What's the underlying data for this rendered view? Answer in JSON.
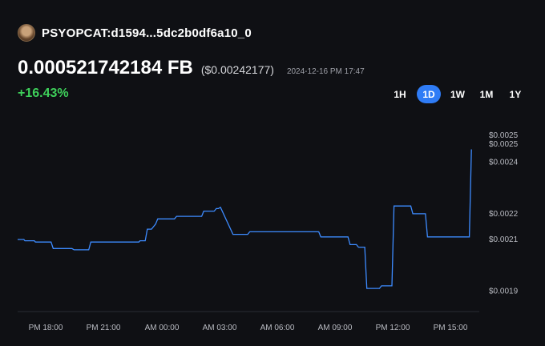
{
  "token": {
    "name": "PSYOPCAT:d1594...5dc2b0df6a10_0",
    "avatar_icon": "cat-avatar-icon"
  },
  "price": {
    "value": "0.000521742184 FB",
    "usd": "($0.00242177)",
    "timestamp": "2024-12-16 PM 17:47",
    "change": "+16.43%",
    "change_color": "#3ecf5a"
  },
  "ranges": {
    "selected": "1D",
    "accent": "#2f7cf6",
    "items": [
      "1H",
      "1D",
      "1W",
      "1M",
      "1Y"
    ]
  },
  "chart_data": {
    "type": "line",
    "line_color": "#3d8bff",
    "ylim": [
      0.00182,
      0.00252
    ],
    "xlim": [
      0,
      20
    ],
    "y_tick_labels": [
      "$0.0025",
      "$0.0025",
      "$0.0024",
      "$0.0022",
      "$0.0021",
      "$0.0019"
    ],
    "y_tick_values": [
      0.0025,
      0.00249,
      0.0024,
      0.0022,
      0.0021,
      0.0019
    ],
    "x_tick_labels": [
      "PM 18:00",
      "PM 21:00",
      "AM 00:00",
      "AM 03:00",
      "AM 06:00",
      "AM 09:00",
      "PM 12:00",
      "PM 15:00"
    ],
    "x_tick_values": [
      1,
      4,
      7,
      10,
      13,
      16,
      19,
      22
    ],
    "x_hours_note": "",
    "series": [
      {
        "x": [
          0.0,
          0.3,
          0.35,
          0.8,
          0.85,
          1.6,
          1.7,
          2.6,
          2.7,
          3.4,
          3.5,
          5.8,
          5.85,
          6.1,
          6.2,
          6.4,
          6.6,
          6.7,
          7.5,
          7.6,
          8.8,
          8.9,
          9.4,
          9.5,
          9.6,
          9.7,
          10.3,
          11.0,
          11.1,
          14.4,
          14.5,
          15.8,
          15.9,
          16.2,
          16.3,
          16.6,
          16.7,
          17.3,
          17.4,
          17.9,
          18.0,
          18.8,
          18.9,
          19.5,
          19.6,
          21.6,
          21.7
        ],
        "y": [
          0.0021,
          0.0021,
          0.002095,
          0.002095,
          0.00209,
          0.00209,
          0.002065,
          0.002065,
          0.00206,
          0.00206,
          0.00209,
          0.00209,
          0.002095,
          0.002095,
          0.00214,
          0.00214,
          0.00216,
          0.00218,
          0.00218,
          0.00219,
          0.00219,
          0.00221,
          0.00221,
          0.00222,
          0.00222,
          0.002225,
          0.00212,
          0.00212,
          0.00213,
          0.00213,
          0.00211,
          0.00211,
          0.00208,
          0.00208,
          0.00207,
          0.00207,
          0.00191,
          0.00191,
          0.00192,
          0.00192,
          0.00223,
          0.00223,
          0.0022,
          0.0022,
          0.00211,
          0.00211,
          0.00245
        ]
      }
    ]
  }
}
